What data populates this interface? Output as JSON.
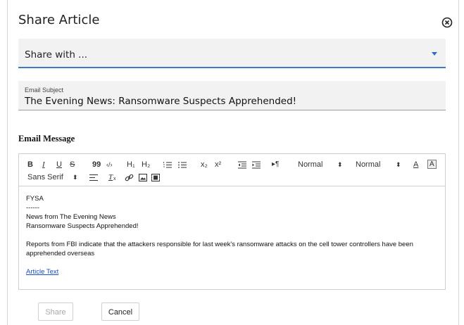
{
  "dialog": {
    "title": "Share Article"
  },
  "share_with": {
    "placeholder": "Share with ..."
  },
  "subject": {
    "label": "Email Subject",
    "value": "The Evening News: Ransomware Suspects Apprehended!"
  },
  "message_label": "Email Message",
  "toolbar": {
    "bold": "B",
    "italic": "I",
    "underline": "U",
    "strike": "S",
    "quote": "99",
    "code": "‹/›",
    "h1": "H₁",
    "h2": "H₂",
    "sub": "x₂",
    "sup": "x²",
    "rtl": "▸¶",
    "size_select": "Normal",
    "heading_select": "Normal",
    "font_select": "Sans Serif"
  },
  "body_lines": [
    "FYSA",
    "------",
    "News from The Evening News",
    "Ransomware Suspects Apprehended!",
    "",
    "Reports from FBI indicate that the attackers responsible for last week's ransomware attacks on the cell tower controllers have been apprehended overseas",
    ""
  ],
  "link_text": "Article Text",
  "buttons": {
    "share": "Share",
    "cancel": "Cancel"
  },
  "colors": {
    "accent": "#3f79c9"
  }
}
